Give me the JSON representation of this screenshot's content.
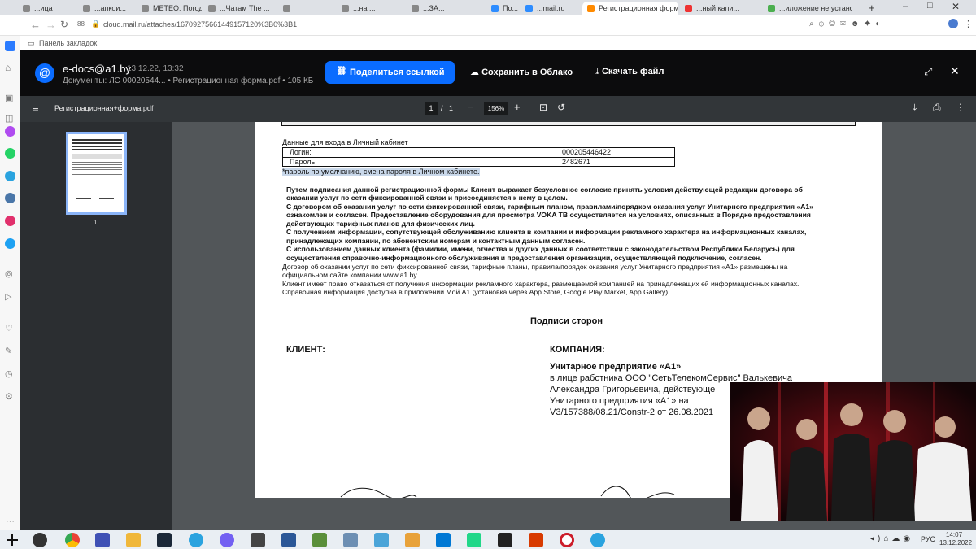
{
  "browser": {
    "tabs": [
      {
        "label": "...ица",
        "x": ""
      },
      {
        "label": "...апкои..."
      },
      {
        "label": "МЕТЕО: Погод..."
      },
      {
        "label": "...Чатам The ..."
      },
      {
        "label": ""
      },
      {
        "label": "...на ..."
      },
      {
        "label": "...ЗА..."
      },
      {
        "label": "По..."
      },
      {
        "label": "...mail.ru"
      },
      {
        "label": "Регистрационная форм"
      },
      {
        "label": "...ный капи..."
      },
      {
        "label": "...иложение не устано..."
      }
    ],
    "url": "cloud.mail.ru/attaches/16709275661449157120%3B0%3B1",
    "bookmarks_label": "Панель закладок"
  },
  "viewer": {
    "sender": "e-docs@a1.by",
    "date": "13.12.22, 13:32",
    "subtitle": "Документы: ЛС 00020544... • Регистрационная форма.pdf • 105 КБ",
    "share_label": "Поделиться ссылкой",
    "save_cloud_label": "Сохранить в Облако",
    "download_label": "Скачать файл"
  },
  "pdf": {
    "filename": "Регистрационная+форма.pdf",
    "page_current": "1",
    "page_sep": "/",
    "page_total": "1",
    "zoom": "156%",
    "thumb_num": "1"
  },
  "doc": {
    "login_heading": "Данные для входа в Личный кабинет",
    "login_label": "Логин:",
    "login_value": "000205446422",
    "password_label": "Пароль:",
    "password_value": "2482671",
    "password_note": "*пароль по умолчанию, смена пароля в Личном кабинете.",
    "p1a": "Путем подписания данной регистрационной формы Клиент выражает безусловное согласие принять условия действующей редакции договора об",
    "p1b": "оказании услуг по сети фиксированной связи и присоединяется к нему в целом.",
    "p2a": "С договором об оказании услуг по сети фиксированной связи, тарифным планом, правилами/порядком оказания услуг Унитарного предприятия «А1»",
    "p2b": "ознакомлен и согласен. Предоставление оборудования для просмотра VOKA ТВ осуществляется на условиях, описанных в Порядке предоставления",
    "p2c": "действующих тарифных планов для физических лиц.",
    "p3a": "С получением информации, сопутствующей обслуживанию клиента в компании и информации рекламного характера на информационных каналах,",
    "p3b": "принадлежащих компании, по абонентским номерам и контактным данным согласен.",
    "p4a": "С использованием данных клиента (фамилии, имени, отчества и других данных в соответствии с законодательством Республики Беларусь) для",
    "p4b": "осуществления справочно-информационного обслуживания и предоставления организации, осуществляющей подключение, согласен.",
    "n1a": "Договор об оказании услуг по сети фиксированной связи, тарифные планы, правила/порядок оказания услуг Унитарного предприятия «А1» размещены на",
    "n1b": "официальном сайте компании www.a1.by.",
    "n2": "Клиент имеет право отказаться от получения информации рекламного характера, размещаемой компанией на принадлежащих ей информационных каналах.",
    "n3": "Справочная информация доступна в приложении Мой А1 (установка через App Store, Google Play Market, App Gallery).",
    "sign_title": "Подписи сторон",
    "client_label": "КЛИЕНТ:",
    "company_label": "КОМПАНИЯ:",
    "company_name": "Унитарное предприятие «А1»",
    "company_l1": "в   лице    работника  ООО  \"СетьТелекомСервис\"  Валькевича",
    "company_l2": "Александра Григорьевича, действующе",
    "company_l3": "Унитарного  предприятия  «А1»       на",
    "company_l4": "V3/157388/08.21/Constr-2  от 26.08.2021"
  },
  "taskbar": {
    "lang": "РУС",
    "time": "14:07",
    "date": "13.12.2022"
  },
  "colors": {
    "accent": "#0a6cff",
    "viewer_bg": "#0c0c0d",
    "pdf_toolbar": "#323639"
  }
}
